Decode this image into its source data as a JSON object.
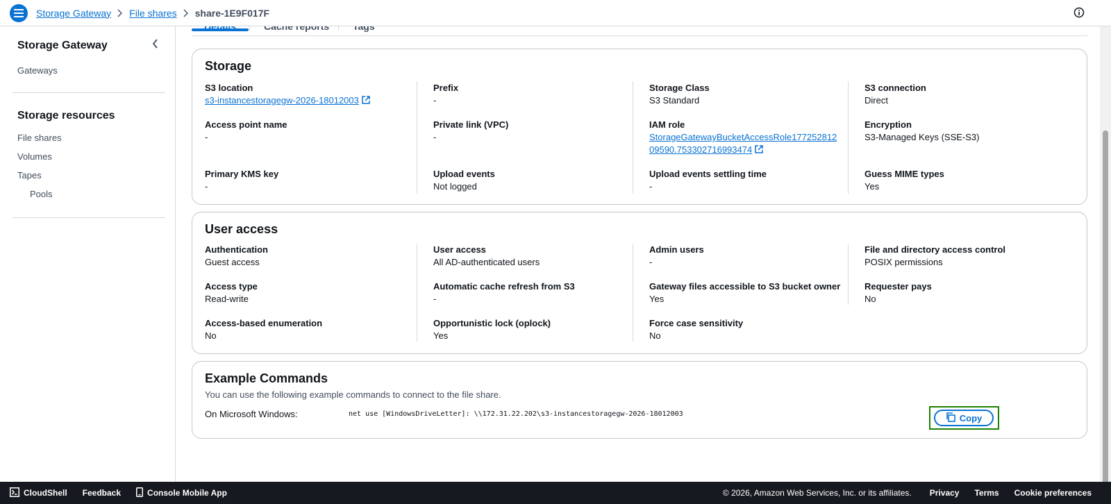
{
  "breadcrumbs": [
    "Storage Gateway",
    "File shares",
    "share-1E9F017F"
  ],
  "sidebar": {
    "title": "Storage Gateway",
    "gateways": "Gateways",
    "resources_title": "Storage resources",
    "items": [
      "File shares",
      "Volumes",
      "Tapes",
      "Pools"
    ]
  },
  "tabs": [
    "Details",
    "Cache reports",
    "Tags"
  ],
  "storage": {
    "title": "Storage",
    "fields": [
      {
        "k": "S3 location",
        "v": "s3-instancestoragegw-2026-18012003"
      },
      {
        "k": "Prefix",
        "v": "-"
      },
      {
        "k": "Storage Class",
        "v": "S3 Standard"
      },
      {
        "k": "S3 connection",
        "v": "Direct"
      },
      {
        "k": "Access point name",
        "v": "-"
      },
      {
        "k": "Private link (VPC)",
        "v": "-"
      },
      {
        "k": "IAM role",
        "v1": "StorageGatewayBucketAccessRole177252812",
        "v2": "09590.753302716993474"
      },
      {
        "k": "Encryption",
        "v": "S3-Managed Keys (SSE-S3)"
      },
      {
        "k": "Primary KMS key",
        "v": "-"
      },
      {
        "k": "Upload events",
        "v": "Not logged"
      },
      {
        "k": "Upload events settling time",
        "v": "-"
      },
      {
        "k": "Guess MIME types",
        "v": "Yes"
      }
    ]
  },
  "user_access": {
    "title": "User access",
    "fields": [
      {
        "k": "Authentication",
        "v": "Guest access"
      },
      {
        "k": "User access",
        "v": "All AD-authenticated users"
      },
      {
        "k": "Admin users",
        "v": "-"
      },
      {
        "k": "File and directory access control",
        "v": "POSIX permissions"
      },
      {
        "k": "Access type",
        "v": "Read-write"
      },
      {
        "k": "Automatic cache refresh from S3",
        "v": "-"
      },
      {
        "k": "Gateway files accessible to S3 bucket owner",
        "v": "Yes"
      },
      {
        "k": "Requester pays",
        "v": "No"
      },
      {
        "k": "Access-based enumeration",
        "v": "No"
      },
      {
        "k": "Opportunistic lock (oplock)",
        "v": "Yes"
      },
      {
        "k": "Force case sensitivity",
        "v": "No"
      }
    ]
  },
  "commands": {
    "title": "Example Commands",
    "description": "You can use the following example commands to connect to the file share.",
    "label": "On Microsoft Windows:",
    "command": "net use [WindowsDriveLetter]: \\\\172.31.22.202\\s3-instancestoragegw-2026-18012003",
    "copy_label": "Copy"
  },
  "footer": {
    "cloudshell": "CloudShell",
    "feedback": "Feedback",
    "mobile": "Console Mobile App",
    "copyright": "© 2026, Amazon Web Services, Inc. or its affiliates.",
    "privacy": "Privacy",
    "terms": "Terms",
    "cookies": "Cookie preferences"
  },
  "colors": {
    "accent": "#0972d3",
    "highlight": "#1d8102",
    "footer_bg": "#16191f"
  }
}
